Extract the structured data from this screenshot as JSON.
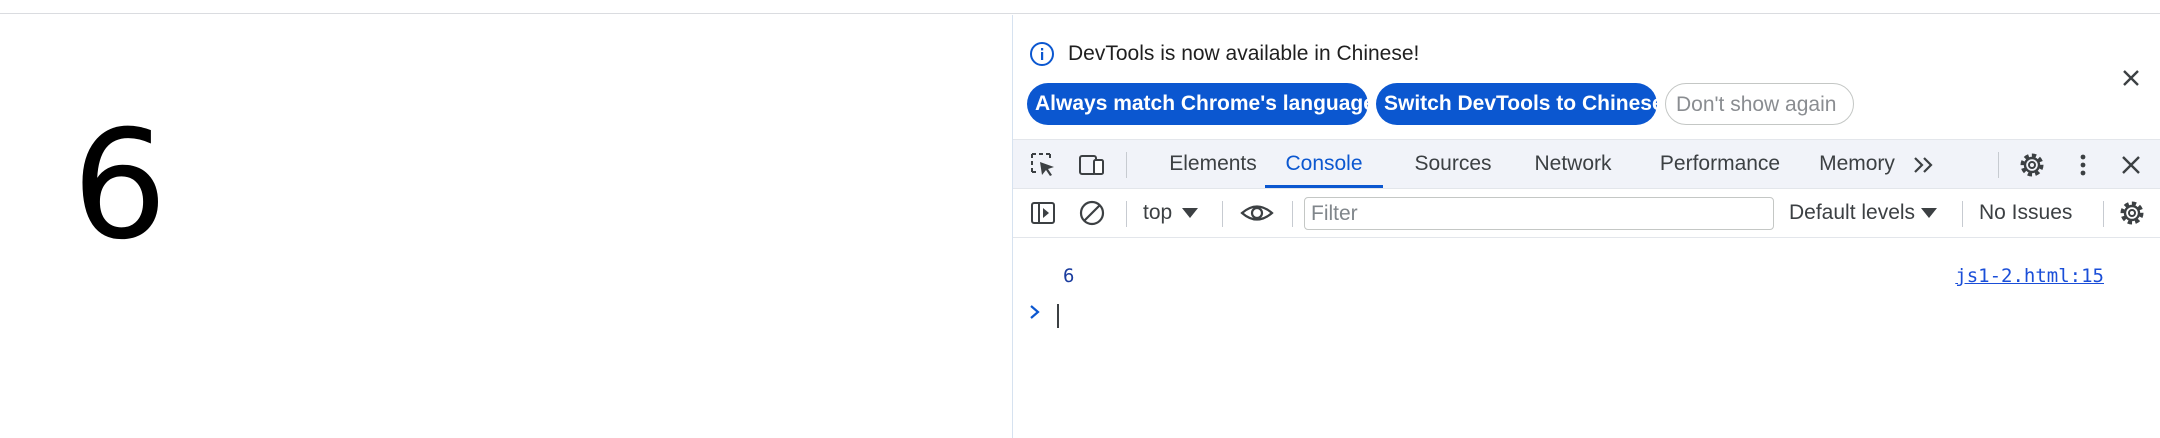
{
  "page": {
    "content": "6"
  },
  "devtools": {
    "infobar": {
      "message": "DevTools is now available in Chinese!",
      "buttons": [
        "Always match Chrome's language",
        "Switch DevTools to Chinese",
        "Don't show again"
      ]
    },
    "tabs": [
      "Elements",
      "Console",
      "Sources",
      "Network",
      "Performance",
      "Memory"
    ],
    "active_tab": "Console",
    "console_toolbar": {
      "context": "top",
      "filter_placeholder": "Filter",
      "levels": "Default levels",
      "issues": "No Issues"
    },
    "log": {
      "value": "6",
      "source": "js1-2.html:15"
    },
    "colors": {
      "accent": "#0b57d0",
      "toolbar_bg": "#f1f3f9"
    }
  }
}
